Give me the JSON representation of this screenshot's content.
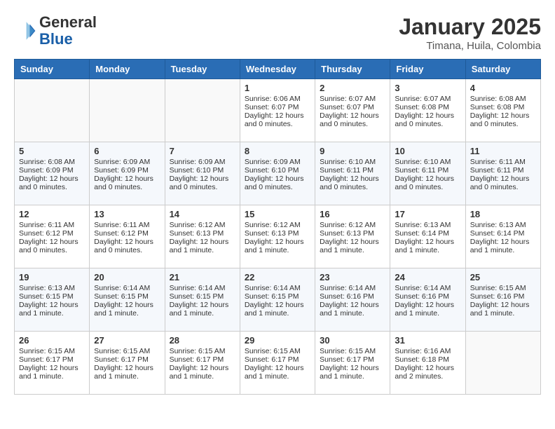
{
  "header": {
    "logo_line1": "General",
    "logo_line2": "Blue",
    "title": "January 2025",
    "subtitle": "Timana, Huila, Colombia"
  },
  "calendar": {
    "days_of_week": [
      "Sunday",
      "Monday",
      "Tuesday",
      "Wednesday",
      "Thursday",
      "Friday",
      "Saturday"
    ],
    "weeks": [
      [
        {
          "day": "",
          "empty": true
        },
        {
          "day": "",
          "empty": true
        },
        {
          "day": "",
          "empty": true
        },
        {
          "day": "1",
          "sunrise": "6:06 AM",
          "sunset": "6:07 PM",
          "daylight": "12 hours and 0 minutes."
        },
        {
          "day": "2",
          "sunrise": "6:07 AM",
          "sunset": "6:07 PM",
          "daylight": "12 hours and 0 minutes."
        },
        {
          "day": "3",
          "sunrise": "6:07 AM",
          "sunset": "6:08 PM",
          "daylight": "12 hours and 0 minutes."
        },
        {
          "day": "4",
          "sunrise": "6:08 AM",
          "sunset": "6:08 PM",
          "daylight": "12 hours and 0 minutes."
        }
      ],
      [
        {
          "day": "5",
          "sunrise": "6:08 AM",
          "sunset": "6:09 PM",
          "daylight": "12 hours and 0 minutes."
        },
        {
          "day": "6",
          "sunrise": "6:09 AM",
          "sunset": "6:09 PM",
          "daylight": "12 hours and 0 minutes."
        },
        {
          "day": "7",
          "sunrise": "6:09 AM",
          "sunset": "6:10 PM",
          "daylight": "12 hours and 0 minutes."
        },
        {
          "day": "8",
          "sunrise": "6:09 AM",
          "sunset": "6:10 PM",
          "daylight": "12 hours and 0 minutes."
        },
        {
          "day": "9",
          "sunrise": "6:10 AM",
          "sunset": "6:11 PM",
          "daylight": "12 hours and 0 minutes."
        },
        {
          "day": "10",
          "sunrise": "6:10 AM",
          "sunset": "6:11 PM",
          "daylight": "12 hours and 0 minutes."
        },
        {
          "day": "11",
          "sunrise": "6:11 AM",
          "sunset": "6:11 PM",
          "daylight": "12 hours and 0 minutes."
        }
      ],
      [
        {
          "day": "12",
          "sunrise": "6:11 AM",
          "sunset": "6:12 PM",
          "daylight": "12 hours and 0 minutes."
        },
        {
          "day": "13",
          "sunrise": "6:11 AM",
          "sunset": "6:12 PM",
          "daylight": "12 hours and 0 minutes."
        },
        {
          "day": "14",
          "sunrise": "6:12 AM",
          "sunset": "6:13 PM",
          "daylight": "12 hours and 1 minute."
        },
        {
          "day": "15",
          "sunrise": "6:12 AM",
          "sunset": "6:13 PM",
          "daylight": "12 hours and 1 minute."
        },
        {
          "day": "16",
          "sunrise": "6:12 AM",
          "sunset": "6:13 PM",
          "daylight": "12 hours and 1 minute."
        },
        {
          "day": "17",
          "sunrise": "6:13 AM",
          "sunset": "6:14 PM",
          "daylight": "12 hours and 1 minute."
        },
        {
          "day": "18",
          "sunrise": "6:13 AM",
          "sunset": "6:14 PM",
          "daylight": "12 hours and 1 minute."
        }
      ],
      [
        {
          "day": "19",
          "sunrise": "6:13 AM",
          "sunset": "6:15 PM",
          "daylight": "12 hours and 1 minute."
        },
        {
          "day": "20",
          "sunrise": "6:14 AM",
          "sunset": "6:15 PM",
          "daylight": "12 hours and 1 minute."
        },
        {
          "day": "21",
          "sunrise": "6:14 AM",
          "sunset": "6:15 PM",
          "daylight": "12 hours and 1 minute."
        },
        {
          "day": "22",
          "sunrise": "6:14 AM",
          "sunset": "6:15 PM",
          "daylight": "12 hours and 1 minute."
        },
        {
          "day": "23",
          "sunrise": "6:14 AM",
          "sunset": "6:16 PM",
          "daylight": "12 hours and 1 minute."
        },
        {
          "day": "24",
          "sunrise": "6:14 AM",
          "sunset": "6:16 PM",
          "daylight": "12 hours and 1 minute."
        },
        {
          "day": "25",
          "sunrise": "6:15 AM",
          "sunset": "6:16 PM",
          "daylight": "12 hours and 1 minute."
        }
      ],
      [
        {
          "day": "26",
          "sunrise": "6:15 AM",
          "sunset": "6:17 PM",
          "daylight": "12 hours and 1 minute."
        },
        {
          "day": "27",
          "sunrise": "6:15 AM",
          "sunset": "6:17 PM",
          "daylight": "12 hours and 1 minute."
        },
        {
          "day": "28",
          "sunrise": "6:15 AM",
          "sunset": "6:17 PM",
          "daylight": "12 hours and 1 minute."
        },
        {
          "day": "29",
          "sunrise": "6:15 AM",
          "sunset": "6:17 PM",
          "daylight": "12 hours and 1 minute."
        },
        {
          "day": "30",
          "sunrise": "6:15 AM",
          "sunset": "6:17 PM",
          "daylight": "12 hours and 1 minute."
        },
        {
          "day": "31",
          "sunrise": "6:16 AM",
          "sunset": "6:18 PM",
          "daylight": "12 hours and 2 minutes."
        },
        {
          "day": "",
          "empty": true
        }
      ]
    ]
  }
}
